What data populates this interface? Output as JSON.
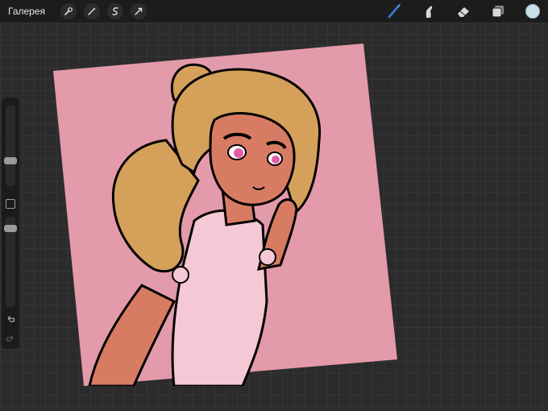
{
  "topbar": {
    "gallery_label": "Галерея",
    "left_tools": [
      "wrench-icon",
      "magic-wand-icon",
      "selection-icon",
      "transform-icon"
    ],
    "right_tools": [
      "brush-icon",
      "smudge-icon",
      "eraser-icon",
      "layers-icon"
    ],
    "current_color": "#c9dfe9"
  },
  "colors": {
    "canvas_bg": "#e39aaa",
    "hair": "#d4a05a",
    "skin": "#d77c63",
    "clothing": "#f4c8d4",
    "eye": "#e35aa5",
    "accent_brush": "#3b7dd8"
  },
  "sidebar": {
    "brush_size_level": 0.5,
    "opacity_level": 0.3
  }
}
